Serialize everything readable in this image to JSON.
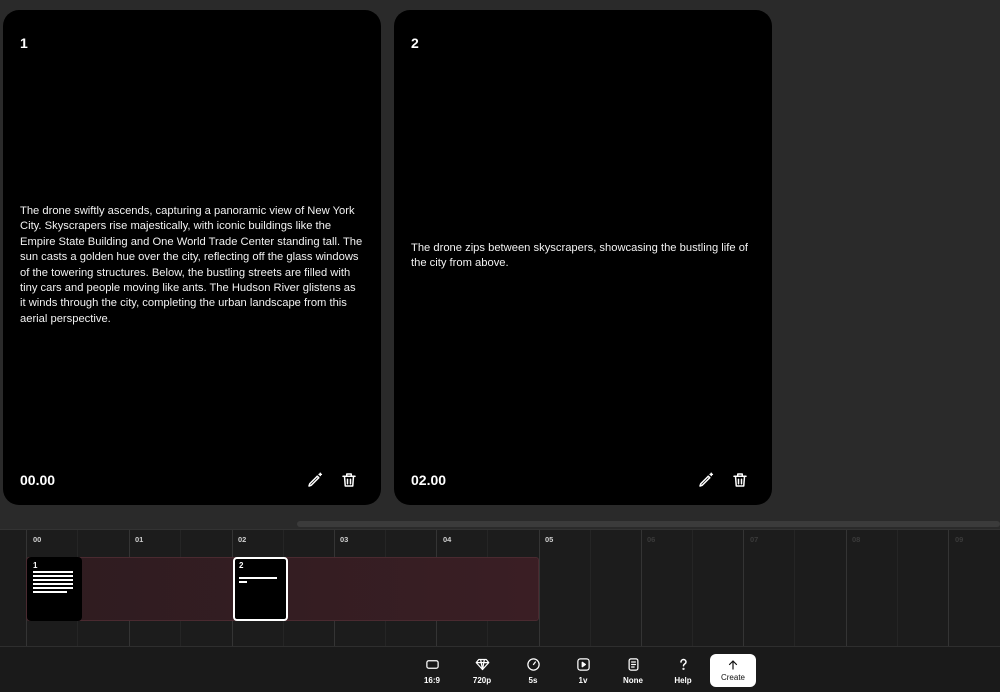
{
  "cards": [
    {
      "number": "1",
      "text": "The drone swiftly ascends, capturing a panoramic view of New York City. Skyscrapers rise majestically, with iconic buildings like the Empire State Building and One World Trade Center standing tall. The sun casts a golden hue over the city, reflecting off the glass windows of the towering structures. Below, the bustling streets are filled with tiny cars and people moving like ants. The Hudson River glistens as it winds through the city, completing the urban landscape from this aerial perspective.",
      "time": "00.00",
      "edit_icon": "magic-pen-icon",
      "delete_icon": "trash-icon"
    },
    {
      "number": "2",
      "text": "The drone zips between skyscrapers, showcasing the bustling life of the city from above.",
      "time": "02.00",
      "edit_icon": "magic-pen-icon",
      "delete_icon": "trash-icon"
    }
  ],
  "timeline": {
    "ticks": [
      "00",
      "01",
      "02",
      "03",
      "04",
      "05",
      "06",
      "07",
      "08",
      "09"
    ],
    "clips": [
      {
        "label": "1"
      },
      {
        "label": "2"
      }
    ]
  },
  "toolbar": {
    "aspect_label": "16:9",
    "quality_label": "720p",
    "duration_label": "5s",
    "versions_label": "1v",
    "style_label": "None",
    "help_label": "Help",
    "create_label": "Create"
  }
}
